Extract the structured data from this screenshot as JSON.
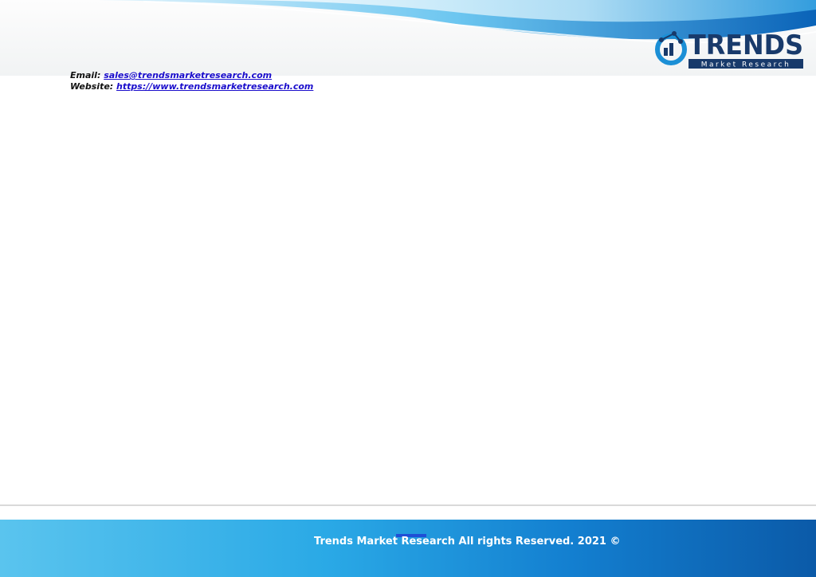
{
  "header": {
    "logo": {
      "wordmark": "TRENDS",
      "tagline": "Market Research",
      "icon": "chart-magnifier-icon"
    }
  },
  "contact": {
    "email_label": "Email:",
    "email": "sales@trendsmarketresearch.com",
    "website_label": "Website:",
    "website": "https://www.trendsmarketresearch.com"
  },
  "footer": {
    "copyright": "Trends Market Research All rights Reserved. 2021 ©"
  },
  "colors": {
    "brand_dark": "#183a6b",
    "brand_blue": "#1b8fd6",
    "link": "#1a0dcc",
    "footer_start": "#5ac4ee",
    "footer_end": "#0b5aa8"
  }
}
